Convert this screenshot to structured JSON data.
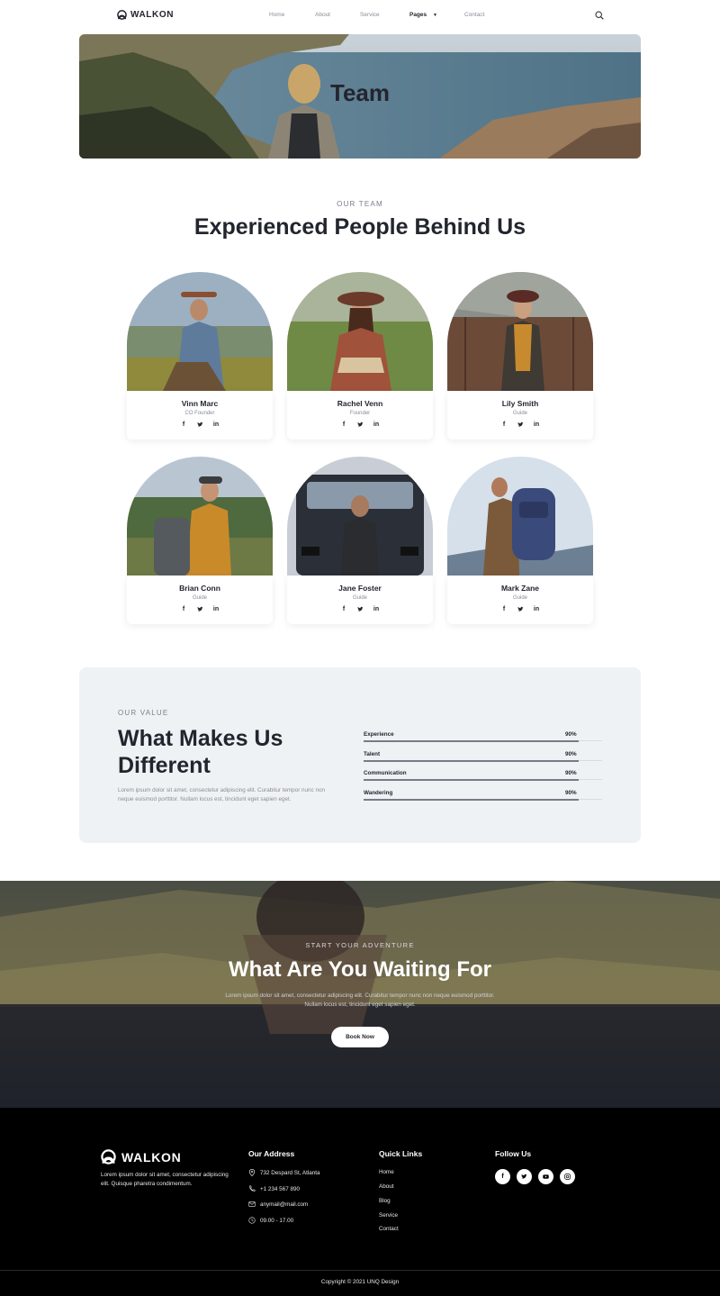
{
  "brand": {
    "name": "WALKON"
  },
  "nav": {
    "items": [
      {
        "label": "Home"
      },
      {
        "label": "About"
      },
      {
        "label": "Service"
      },
      {
        "label": "Pages",
        "has_dropdown": true,
        "active": true
      },
      {
        "label": "Contact"
      }
    ],
    "search_icon": "search-icon"
  },
  "hero": {
    "title": "Team"
  },
  "team": {
    "eyebrow": "OUR TEAM",
    "title": "Experienced People Behind Us",
    "members": [
      {
        "name": "Vinn Marc",
        "role": "CO Founder"
      },
      {
        "name": "Rachel Venn",
        "role": "Founder"
      },
      {
        "name": "Lily Smith",
        "role": "Guide"
      },
      {
        "name": "Brian Conn",
        "role": "Guide"
      },
      {
        "name": "Jane Foster",
        "role": "Guide"
      },
      {
        "name": "Mark Zane",
        "role": "Guide"
      }
    ],
    "social_icons": [
      "facebook-icon",
      "twitter-icon",
      "linkedin-icon"
    ]
  },
  "value": {
    "eyebrow": "OUR VALUE",
    "title_line1": "What Makes Us",
    "title_line2": "Different",
    "description": "Lorem ipsum dolor sit amet, consectetur adipiscing elit. Curabitur tempor nunc non neque euismod porttitor. Nullam locus est, tincidunt eget sapien eget.",
    "skills": [
      {
        "label": "Experience",
        "percent_label": "90%",
        "percent": 90
      },
      {
        "label": "Talent",
        "percent_label": "90%",
        "percent": 90
      },
      {
        "label": "Communication",
        "percent_label": "90%",
        "percent": 90
      },
      {
        "label": "Wandering",
        "percent_label": "90%",
        "percent": 90
      }
    ]
  },
  "cta": {
    "eyebrow": "START YOUR ADVENTURE",
    "title": "What Are You Waiting For",
    "description": "Lorem ipsum dolor sit amet, consectetur adipiscing elit. Curabitur tempor nunc non neque euismod porttitor. Nullam locus est, tincidunt eget sapien eget.",
    "button_label": "Book Now"
  },
  "footer": {
    "brand": "WALKON",
    "description": "Lorem ipsum dolor sit amet, consectetur adipiscing elit. Quisque pharetra condimentum.",
    "address_heading": "Our Address",
    "address": [
      {
        "icon": "location-pin-icon",
        "text": "732 Despard St, Atlanta"
      },
      {
        "icon": "phone-icon",
        "text": "+1 234 567 890"
      },
      {
        "icon": "mail-icon",
        "text": "anymail@mail.com"
      },
      {
        "icon": "clock-icon",
        "text": "09.00 - 17.00"
      }
    ],
    "links_heading": "Quick Links",
    "links": [
      "Home",
      "About",
      "Blog",
      "Service",
      "Contact"
    ],
    "follow_heading": "Follow Us",
    "social_icons": [
      "facebook-icon",
      "twitter-icon",
      "youtube-icon",
      "instagram-icon"
    ],
    "copyright": "Copyright © 2021 UNQ Design"
  }
}
